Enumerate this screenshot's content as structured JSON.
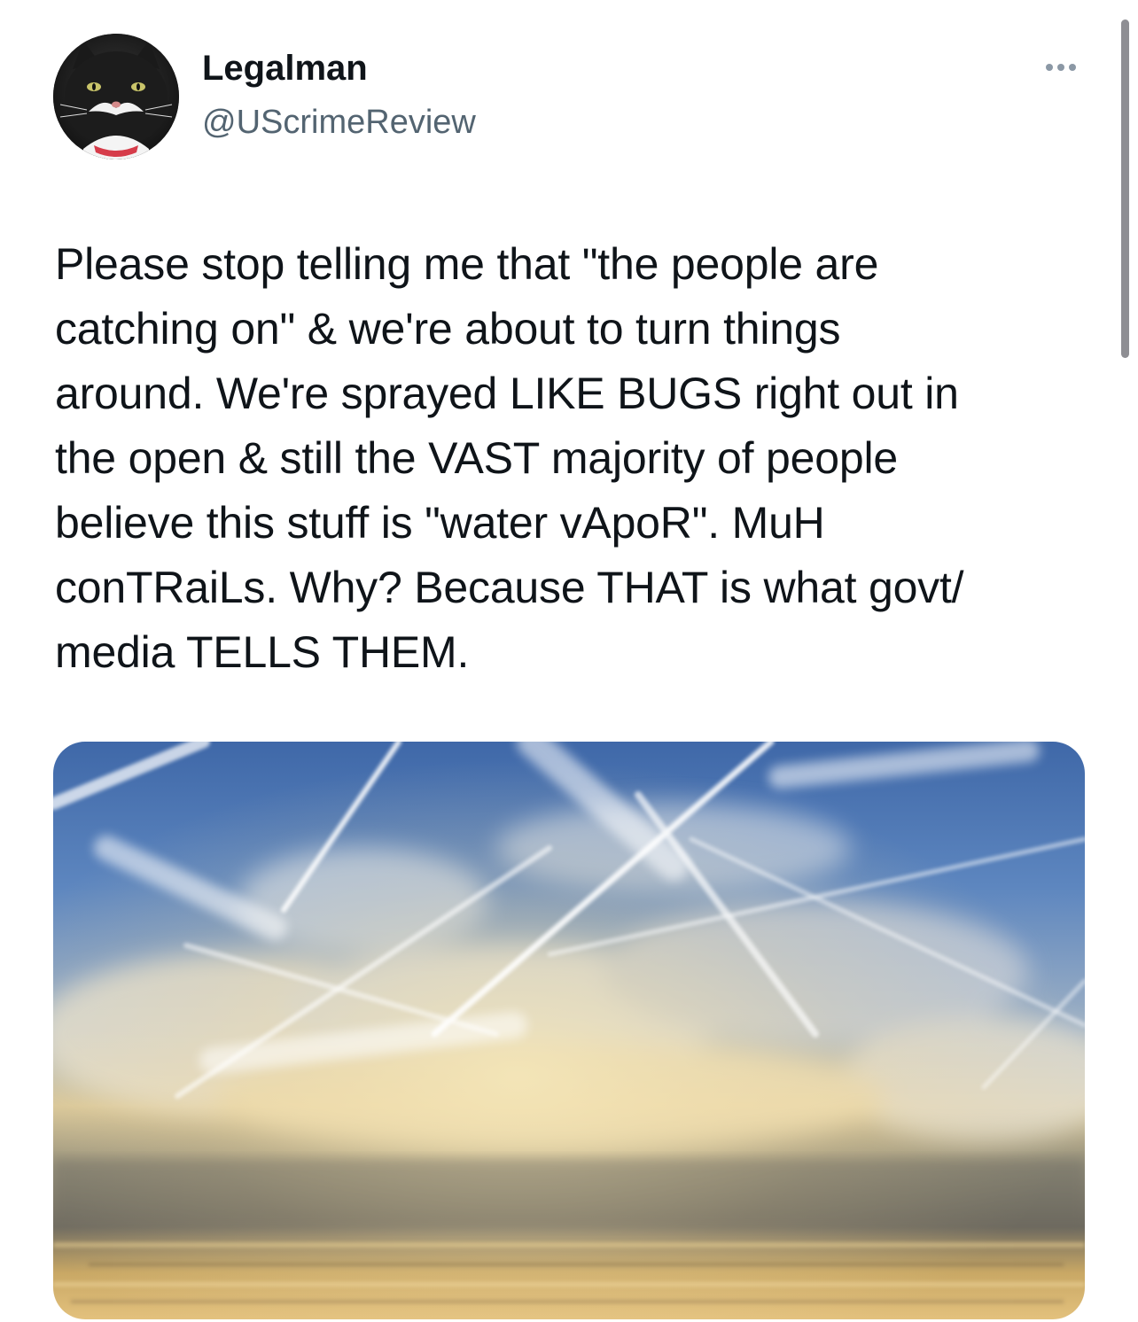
{
  "tweet": {
    "display_name": "Legalman",
    "handle": "@UScrimeReview",
    "text": "Please stop telling me that \"the people are\ncatching on\" & we're about to turn things\naround. We're sprayed LIKE BUGS right out in\nthe open & still the VAST majority of people\nbelieve this stuff is \"water vApoR\". MuH\nconTRaiLs. Why? Because THAT is what govt/\nmedia TELLS THEM.",
    "avatar_icon": "tuxedo-cat-avatar",
    "more_icon": "more-options-icon",
    "media_description_icon": "sky-contrails-photo"
  },
  "colors": {
    "text_primary": "#0f1419",
    "text_secondary": "#536471",
    "background": "#ffffff"
  }
}
